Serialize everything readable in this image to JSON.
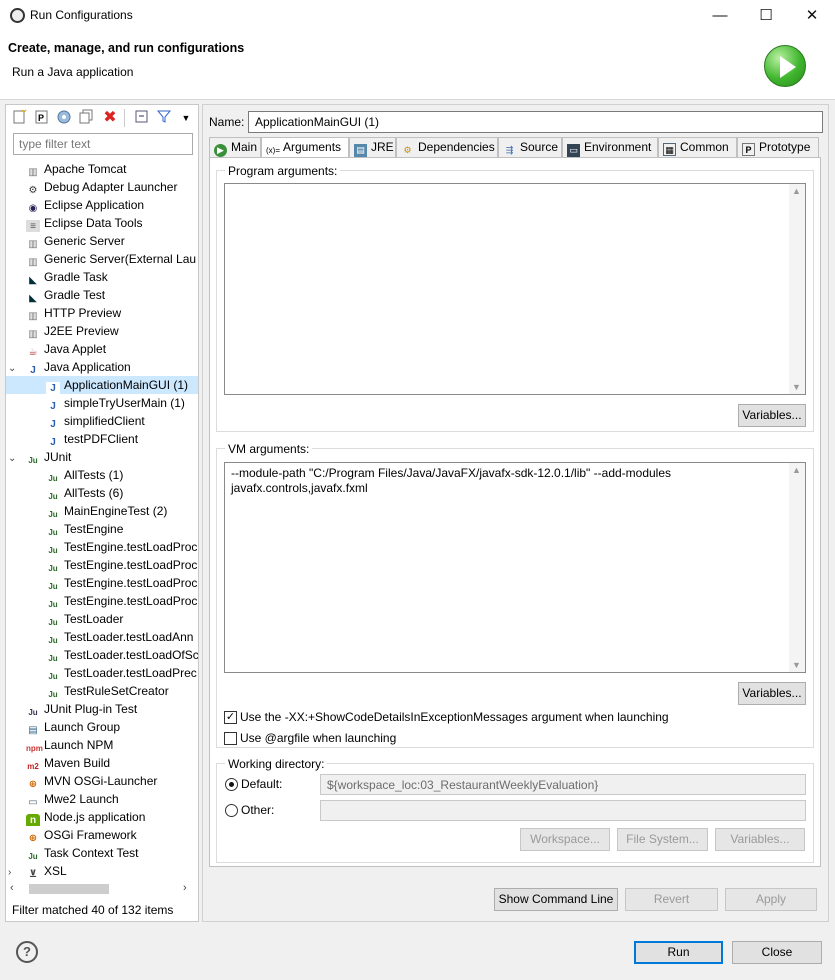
{
  "window": {
    "title": "Run Configurations",
    "minimize": "—",
    "maximize": "☐",
    "close": "✕"
  },
  "header": {
    "title": "Create, manage, and run configurations",
    "subtitle": "Run a Java application",
    "icon": "run-icon"
  },
  "toolbar": {
    "icons": [
      "new-config-icon",
      "new-prototype-icon",
      "export-icon",
      "duplicate-icon",
      "delete-icon",
      "collapse-all-icon",
      "filter-icon",
      "view-menu-icon"
    ]
  },
  "filter": {
    "placeholder": "type filter text"
  },
  "tree": [
    {
      "label": "Apache Tomcat",
      "icon": "server-icon",
      "level": 1
    },
    {
      "label": "Debug Adapter Launcher",
      "icon": "gear-icon",
      "level": 1
    },
    {
      "label": "Eclipse Application",
      "icon": "eclipse-icon",
      "level": 1
    },
    {
      "label": "Eclipse Data Tools",
      "icon": "database-icon",
      "level": 1
    },
    {
      "label": "Generic Server",
      "icon": "server-icon",
      "level": 1
    },
    {
      "label": "Generic Server(External Lau",
      "icon": "server-icon",
      "level": 1
    },
    {
      "label": "Gradle Task",
      "icon": "gradle-icon",
      "level": 1
    },
    {
      "label": "Gradle Test",
      "icon": "gradle-icon",
      "level": 1
    },
    {
      "label": "HTTP Preview",
      "icon": "server-icon",
      "level": 1
    },
    {
      "label": "J2EE Preview",
      "icon": "server-icon",
      "level": 1
    },
    {
      "label": "Java Applet",
      "icon": "applet-icon",
      "level": 1
    },
    {
      "label": "Java Application",
      "icon": "java-app-icon",
      "level": 1,
      "expanded": true
    },
    {
      "label": "ApplicationMainGUI (1)",
      "icon": "java-app-icon",
      "level": 2,
      "selected": true
    },
    {
      "label": "simpleTryUserMain (1)",
      "icon": "java-app-icon",
      "level": 2
    },
    {
      "label": "simplifiedClient",
      "icon": "java-app-icon",
      "level": 2
    },
    {
      "label": "testPDFClient",
      "icon": "java-app-icon",
      "level": 2
    },
    {
      "label": "JUnit",
      "icon": "junit-icon",
      "level": 1,
      "expanded": true
    },
    {
      "label": "AllTests (1)",
      "icon": "junit-icon",
      "level": 2
    },
    {
      "label": "AllTests (6)",
      "icon": "junit-icon",
      "level": 2
    },
    {
      "label": "MainEngineTest (2)",
      "icon": "junit-icon",
      "level": 2
    },
    {
      "label": "TestEngine",
      "icon": "junit-icon",
      "level": 2
    },
    {
      "label": "TestEngine.testLoadProc",
      "icon": "junit-icon",
      "level": 2
    },
    {
      "label": "TestEngine.testLoadProc",
      "icon": "junit-icon",
      "level": 2
    },
    {
      "label": "TestEngine.testLoadProc",
      "icon": "junit-icon",
      "level": 2
    },
    {
      "label": "TestEngine.testLoadProc",
      "icon": "junit-icon",
      "level": 2
    },
    {
      "label": "TestLoader",
      "icon": "junit-icon",
      "level": 2
    },
    {
      "label": "TestLoader.testLoadAnn",
      "icon": "junit-icon",
      "level": 2
    },
    {
      "label": "TestLoader.testLoadOfSc",
      "icon": "junit-icon",
      "level": 2
    },
    {
      "label": "TestLoader.testLoadPrec",
      "icon": "junit-icon",
      "level": 2
    },
    {
      "label": "TestRuleSetCreator",
      "icon": "junit-icon",
      "level": 2
    },
    {
      "label": "JUnit Plug-in Test",
      "icon": "junit-plugin-icon",
      "level": 1
    },
    {
      "label": "Launch Group",
      "icon": "launch-group-icon",
      "level": 1
    },
    {
      "label": "Launch NPM",
      "icon": "npm-icon",
      "level": 1
    },
    {
      "label": "Maven Build",
      "icon": "maven-icon",
      "level": 1
    },
    {
      "label": "MVN OSGi-Launcher",
      "icon": "osgi-icon",
      "level": 1
    },
    {
      "label": "Mwe2 Launch",
      "icon": "mwe2-icon",
      "level": 1
    },
    {
      "label": "Node.js application",
      "icon": "nodejs-icon",
      "level": 1
    },
    {
      "label": "OSGi Framework",
      "icon": "osgi-icon",
      "level": 1
    },
    {
      "label": "Task Context Test",
      "icon": "junit-icon",
      "level": 1
    },
    {
      "label": "XSL",
      "icon": "xsl-icon",
      "level": 1,
      "collapsed": true
    }
  ],
  "filter_status": "Filter matched 40 of 132 items",
  "name": {
    "label": "Name:",
    "value": "ApplicationMainGUI (1)"
  },
  "tabs": [
    {
      "label": "Main",
      "icon": "main-icon"
    },
    {
      "label": "Arguments",
      "icon": "arguments-icon",
      "active": true
    },
    {
      "label": "JRE",
      "icon": "jre-icon"
    },
    {
      "label": "Dependencies",
      "icon": "dependencies-icon"
    },
    {
      "label": "Source",
      "icon": "source-icon"
    },
    {
      "label": "Environment",
      "icon": "environment-icon"
    },
    {
      "label": "Common",
      "icon": "common-icon"
    },
    {
      "label": "Prototype",
      "icon": "prototype-icon"
    }
  ],
  "program_args": {
    "label": "Program arguments:",
    "value": "",
    "variables": "Variables..."
  },
  "vm_args": {
    "label": "VM arguments:",
    "line1": "--module-path \"C:/Program Files/Java/JavaFX/javafx-sdk-12.0.1/lib\" --add-modules",
    "line2": "javafx.controls,javafx.fxml",
    "variables": "Variables..."
  },
  "check_showcode": {
    "label": "Use the -XX:+ShowCodeDetailsInExceptionMessages argument when launching",
    "checked": true
  },
  "check_argfile": {
    "label": "Use @argfile when launching",
    "checked": false
  },
  "workdir": {
    "label": "Working directory:",
    "default_label": "Default:",
    "default_value": "${workspace_loc:03_RestaurantWeeklyEvaluation}",
    "other_label": "Other:",
    "other_value": "",
    "workspace": "Workspace...",
    "filesystem": "File System...",
    "variables": "Variables..."
  },
  "actions": {
    "show_cmd": "Show Command Line",
    "revert": "Revert",
    "apply": "Apply"
  },
  "footer": {
    "help": "?",
    "run": "Run",
    "close": "Close"
  }
}
